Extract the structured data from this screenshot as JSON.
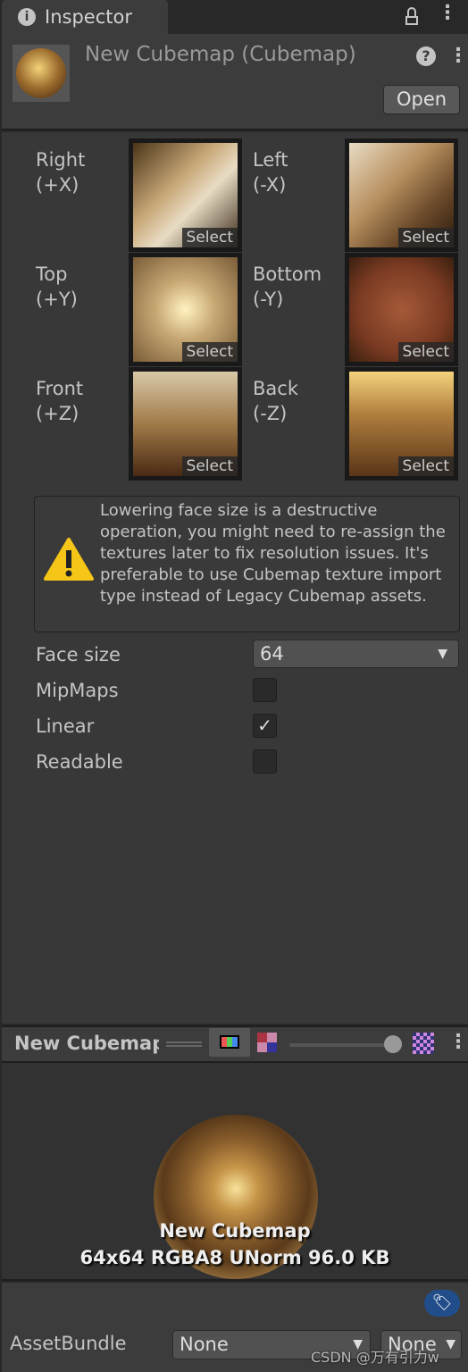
{
  "tab": {
    "title": "Inspector",
    "icon": "info-icon"
  },
  "header": {
    "title": "New Cubemap (Cubemap)",
    "open_label": "Open"
  },
  "faces": [
    {
      "name": "Right",
      "axis": "(+X)",
      "select": "Select"
    },
    {
      "name": "Left",
      "axis": "(-X)",
      "select": "Select"
    },
    {
      "name": "Top",
      "axis": "(+Y)",
      "select": "Select"
    },
    {
      "name": "Bottom",
      "axis": "(-Y)",
      "select": "Select"
    },
    {
      "name": "Front",
      "axis": "(+Z)",
      "select": "Select"
    },
    {
      "name": "Back",
      "axis": "(-Z)",
      "select": "Select"
    }
  ],
  "warning": "Lowering face size is a destructive operation, you might need to re-assign the textures later to fix resolution issues. It's preferable to use Cubemap texture import type instead of Legacy Cubemap assets.",
  "fields": {
    "face_size": {
      "label": "Face size",
      "value": "64"
    },
    "mipmaps": {
      "label": "MipMaps",
      "checked": false
    },
    "linear": {
      "label": "Linear",
      "checked": true,
      "check": "✓"
    },
    "readable": {
      "label": "Readable",
      "checked": false
    }
  },
  "preview": {
    "title": "New Cubemap",
    "name": "New Cubemap",
    "info": "64x64  RGBA8 UNorm   96.0 KB",
    "mip_slider": 1.0
  },
  "asset_bundle": {
    "label": "AssetBundle",
    "value": "None",
    "variant": "None"
  },
  "watermark": "CSDN @万有引力w"
}
